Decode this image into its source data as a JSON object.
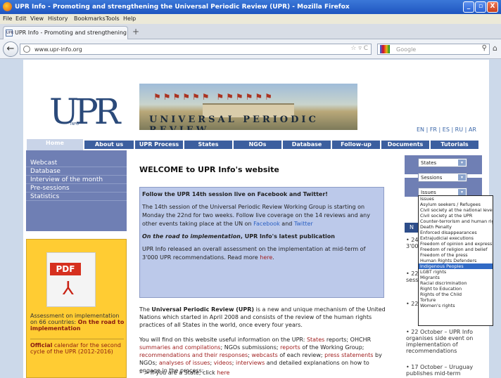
{
  "window": {
    "title": "UPR Info - Promoting and strengthening the Universal Periodic Review (UPR) - Mozilla Firefox",
    "controls": [
      "_",
      "▫",
      "X"
    ]
  },
  "menubar": [
    "File",
    "Edit",
    "View",
    "History",
    "Bookmarks",
    "Tools",
    "Help"
  ],
  "tab": {
    "favicon": "UPR",
    "label": "UPR Info - Promoting and strengthening the ...",
    "newtab": "+"
  },
  "navbar": {
    "back": "←",
    "url": "www.upr-info.org",
    "url_icons": "☆ ▿ C",
    "search_placeholder": "Google",
    "search_icon": "⚲",
    "home_icon": "⌂"
  },
  "site": {
    "logo": "UPR",
    "logo_sub": "INFO",
    "banner_text": "UNIVERSAL PERIODIC REVIEW",
    "banner_flags": "⚑⚑⚑⚑⚑⚑ ⚑⚑⚑⚑⚑⚑",
    "languages": "EN | FR | ES | RU | AR",
    "nav": [
      "Home",
      "About us",
      "UPR Process",
      "States",
      "NGOs",
      "Database",
      "Follow-up",
      "Documents",
      "Tutorials"
    ],
    "leftmenu": [
      "Webcast",
      "Database",
      "Interview of the month",
      "Pre-sessions",
      "Statistics"
    ],
    "pdf": {
      "label": "PDF",
      "acro": "⅄",
      "assess_text": "Assessment on implementation on 66 countries: ",
      "assess_link": "On the road to implementation",
      "calendar_link": "Official",
      "calendar_text": " calendar for the second cycle of the UPR (2012-2016)"
    }
  },
  "main": {
    "heading": "WELCOME to UPR Info's website",
    "highlight": {
      "title": "Follow the UPR 14th session live on Facebook and Twitter!",
      "p1": "The 14th session of the Universal Periodic Review Working Group is starting on Monday the 22nd for two weeks. Follow live coverage on the 14 reviews and any other events taking place at the UN on ",
      "facebook": "Facebook",
      "and": " and ",
      "twitter": "Twitter",
      "p2_italic": "On the road to implementation",
      "p2_rest": ", UPR Info's latest publication",
      "p3": "UPR Info released an overall assessment on the implementation at mid-term of 3'000 UPR recommendations. Read more ",
      "here": "here",
      "dot": "."
    },
    "body1_pre": "The ",
    "body1_bold": "Universal Periodic Review (UPR)",
    "body1_post": " is a new and unique mechanism of the United Nations which started in April 2008 and consists of the review of the human rights practices of all States in the world, once every four years.",
    "body2": {
      "t1": "You will find on this website useful information on the UPR: ",
      "states": "States",
      "t2": " reports; OHCHR ",
      "summaries": "summaries and compilations",
      "t3": "; NGOs submissions; ",
      "reports": "reports",
      "t4": " of the Working Group; ",
      "recs": "recommendations and their responses",
      "t5": "; ",
      "webcasts": "webcasts",
      "t6": " of each review; ",
      "press": "press statements",
      "t7": " by NGOs; ",
      "analyses": "analyses of issues",
      "t8": "; ",
      "videos": "videos",
      "t9": "; ",
      "interviews": "interviews",
      "t10": " and detailed explanations on how to engage in the process:"
    },
    "body3_pre": "– > If you are a State, click ",
    "body3_link": "here"
  },
  "sidebar": {
    "selects": [
      {
        "label": "States",
        "arrow": "▾"
      },
      {
        "label": "Sessions",
        "arrow": "▾"
      },
      {
        "label": "Issues",
        "arrow": "▾"
      }
    ],
    "news_header": "N",
    "news": [
      "• 24 ... Pub... the ... 3'00...",
      "• 22 ... of N... held ... sess...",
      "• 22 ... spa... ava...",
      "• 22 October – UPR Info organises side event on implementation of recommendations",
      "• 17 October – Uruguay publishes mid-term"
    ]
  },
  "dropdown": {
    "options": [
      "Issues",
      "Asylum seekers / Refugees",
      "Civil society at the national level",
      "Civil society at the UPR",
      "Counter-terrorism and human rights",
      "Death Penalty",
      "Enforced disappearances",
      "Extrajudicial executions",
      "Freedom of opinion and expression",
      "Freedom of religion and belief",
      "Freedom of the press",
      "Human Rights Defenders",
      "Indigenous Peoples",
      "LGBT rights",
      "Migrants",
      "Racial discrimination",
      "Right to Education",
      "Rights of the Child",
      "Torture",
      "Women's rights"
    ],
    "highlighted": "Indigenous Peoples"
  }
}
